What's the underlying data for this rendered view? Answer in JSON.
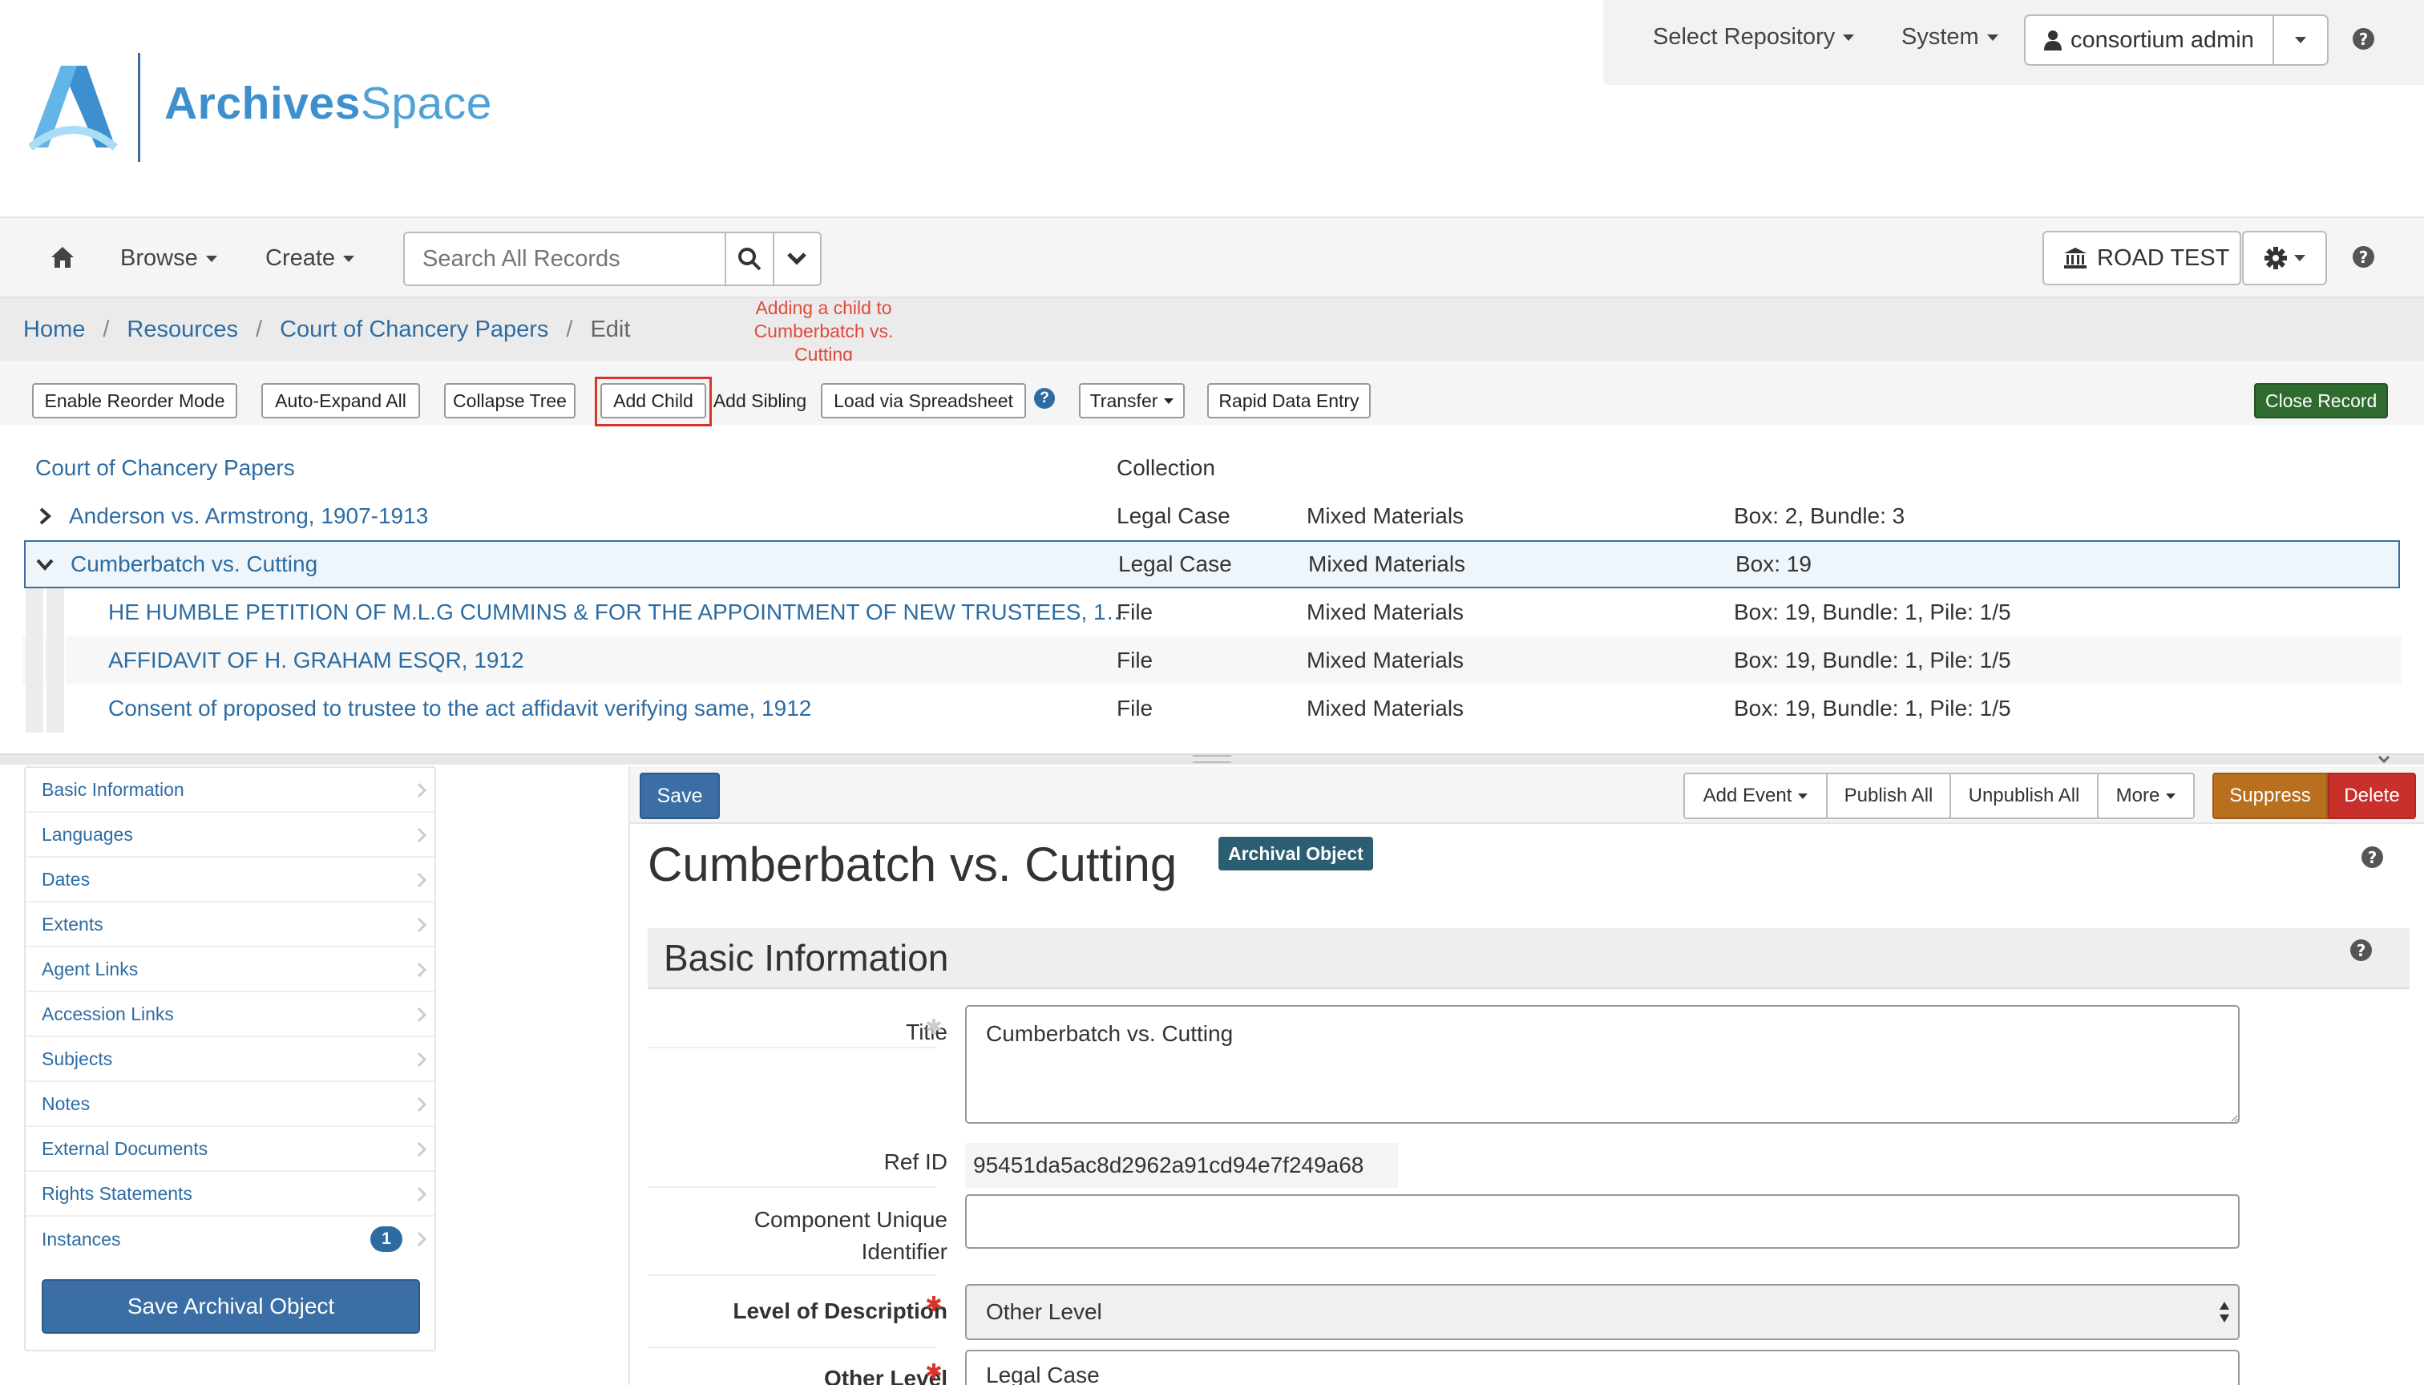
{
  "header": {
    "logo_text_bold": "Archives",
    "logo_text_light": "Space",
    "select_repository": "Select Repository",
    "system": "System",
    "user_name": "consortium admin"
  },
  "nav": {
    "browse": "Browse",
    "create": "Create",
    "search_placeholder": "Search All Records",
    "repository_name": "ROAD TEST"
  },
  "breadcrumb": {
    "items": [
      "Home",
      "Resources",
      "Court of Chancery Papers"
    ],
    "current": "Edit"
  },
  "annotation": "Adding a child to Cumberbatch vs. Cutting",
  "toolbar": {
    "enable_reorder": "Enable Reorder Mode",
    "auto_expand": "Auto-Expand All",
    "collapse_tree": "Collapse Tree",
    "add_child": "Add Child",
    "add_sibling": "Add Sibling",
    "load_spreadsheet": "Load via Spreadsheet",
    "transfer": "Transfer",
    "rapid_data_entry": "Rapid Data Entry",
    "close_record": "Close Record"
  },
  "tree": {
    "root": {
      "title": "Court of Chancery Papers",
      "level": "Collection"
    },
    "rows": [
      {
        "title": "Anderson vs. Armstrong, 1907-1913",
        "level": "Legal Case",
        "type": "Mixed Materials",
        "container": "Box: 2, Bundle: 3"
      },
      {
        "title": "Cumberbatch vs. Cutting",
        "level": "Legal Case",
        "type": "Mixed Materials",
        "container": "Box: 19"
      },
      {
        "title": "HE HUMBLE PETITION OF M.L.G CUMMINS & FOR THE APPOINTMENT OF NEW TRUSTEES, 1…",
        "level": "File",
        "type": "Mixed Materials",
        "container": "Box: 19, Bundle: 1, Pile: 1/5"
      },
      {
        "title": "AFFIDAVIT OF H. GRAHAM ESQR, 1912",
        "level": "File",
        "type": "Mixed Materials",
        "container": "Box: 19, Bundle: 1, Pile: 1/5"
      },
      {
        "title": "Consent of proposed to trustee to the act affidavit verifying same, 1912",
        "level": "File",
        "type": "Mixed Materials",
        "container": "Box: 19, Bundle: 1, Pile: 1/5"
      }
    ]
  },
  "sidebar": {
    "items": [
      {
        "label": "Basic Information"
      },
      {
        "label": "Languages"
      },
      {
        "label": "Dates"
      },
      {
        "label": "Extents"
      },
      {
        "label": "Agent Links"
      },
      {
        "label": "Accession Links"
      },
      {
        "label": "Subjects"
      },
      {
        "label": "Notes"
      },
      {
        "label": "External Documents"
      },
      {
        "label": "Rights Statements"
      },
      {
        "label": "Instances",
        "badge": "1"
      }
    ],
    "save_button": "Save Archival Object"
  },
  "form": {
    "save": "Save",
    "add_event": "Add Event",
    "publish_all": "Publish All",
    "unpublish_all": "Unpublish All",
    "more": "More",
    "suppress": "Suppress",
    "delete": "Delete",
    "record_title": "Cumberbatch vs. Cutting",
    "record_type": "Archival Object",
    "section_title": "Basic Information",
    "fields": {
      "title_label": "Title",
      "title_value": "Cumberbatch vs. Cutting",
      "ref_id_label": "Ref ID",
      "ref_id_value": "95451da5ac8d2962a91cd94e7f249a68",
      "cui_label_1": "Component Unique",
      "cui_label_2": "Identifier",
      "cui_value": "",
      "lod_label": "Level of Description",
      "lod_value": "Other Level",
      "other_level_label": "Other Level",
      "other_level_value": "Legal Case"
    }
  },
  "colors": {
    "link": "#2d6ca2",
    "primary": "#3a6ea5",
    "success": "#2f6b2f",
    "warning": "#b8701f",
    "danger": "#c9302c",
    "annotation": "#e04a3b"
  }
}
